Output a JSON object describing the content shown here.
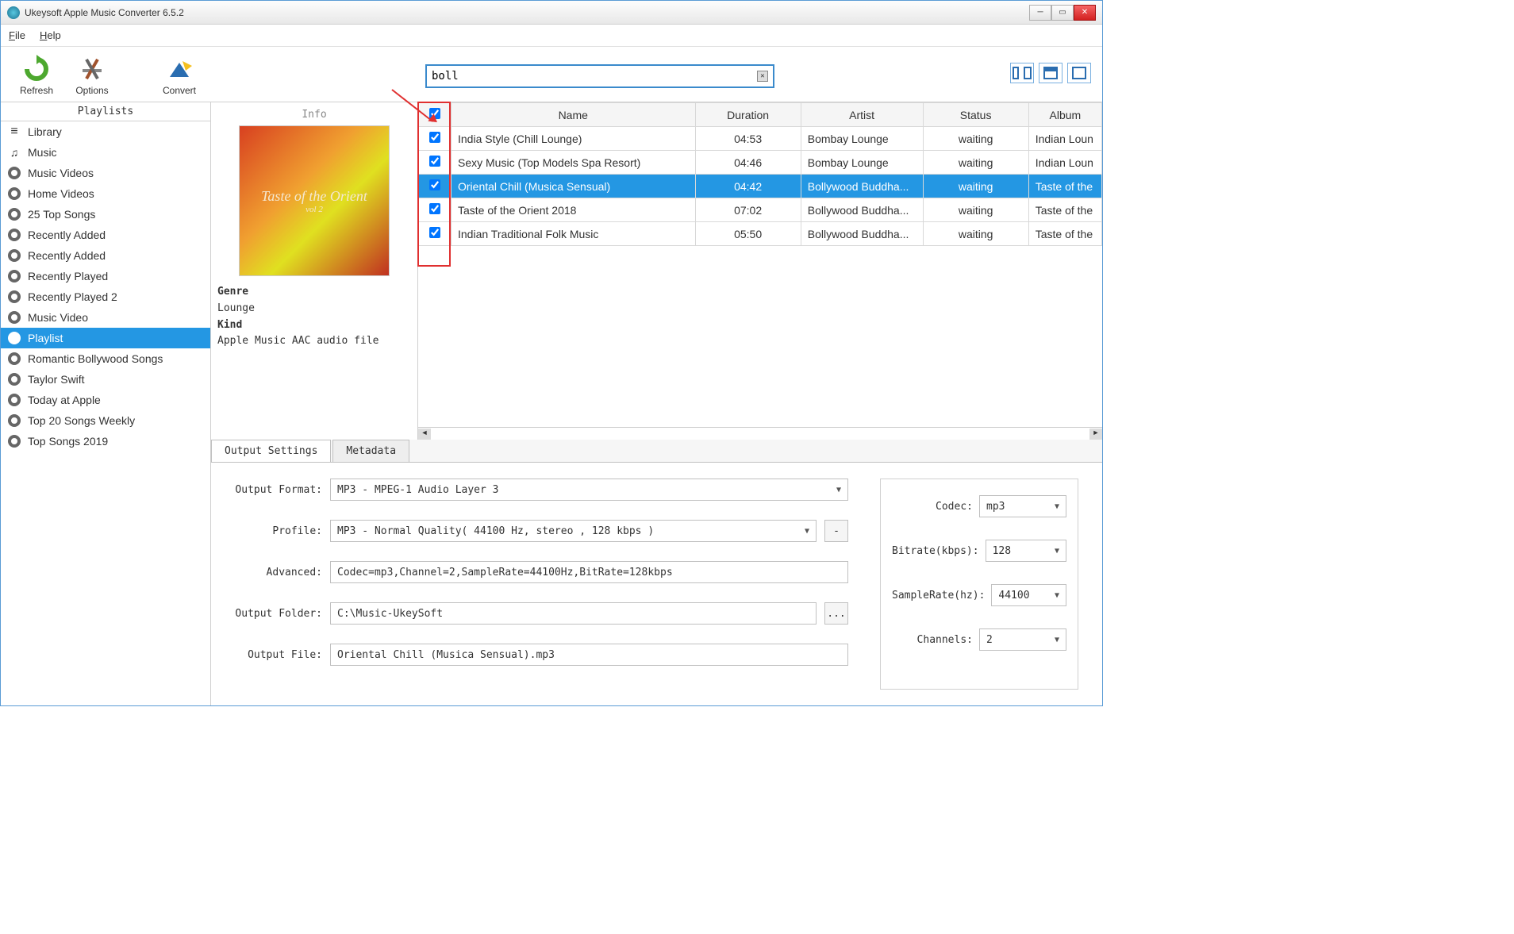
{
  "window": {
    "title": "Ukeysoft Apple Music Converter 6.5.2"
  },
  "menu": {
    "file": "File",
    "help": "Help"
  },
  "toolbar": {
    "refresh": "Refresh",
    "options": "Options",
    "convert": "Convert"
  },
  "search": {
    "value": "boll"
  },
  "sidebar": {
    "header": "Playlists",
    "items": [
      {
        "label": "Library",
        "icon": "list"
      },
      {
        "label": "Music",
        "icon": "note"
      },
      {
        "label": "Music Videos",
        "icon": "gear"
      },
      {
        "label": "Home Videos",
        "icon": "gear"
      },
      {
        "label": "25 Top Songs",
        "icon": "gear"
      },
      {
        "label": "Recently Added",
        "icon": "gear"
      },
      {
        "label": "Recently Added",
        "icon": "gear"
      },
      {
        "label": "Recently Played",
        "icon": "gear"
      },
      {
        "label": "Recently Played 2",
        "icon": "gear"
      },
      {
        "label": "Music Video",
        "icon": "gear"
      },
      {
        "label": "Playlist",
        "icon": "gear",
        "selected": true
      },
      {
        "label": "Romantic Bollywood Songs",
        "icon": "gear"
      },
      {
        "label": "Taylor Swift",
        "icon": "gear"
      },
      {
        "label": "Today at Apple",
        "icon": "gear"
      },
      {
        "label": "Top 20 Songs Weekly",
        "icon": "gear"
      },
      {
        "label": "Top Songs 2019",
        "icon": "gear"
      }
    ]
  },
  "info": {
    "header": "Info",
    "album_line1": "Taste of the Orient",
    "album_line2": "vol 2",
    "genre_label": "Genre",
    "genre": "Lounge",
    "kind_label": "Kind",
    "kind": "Apple Music AAC audio file"
  },
  "table": {
    "columns": {
      "name": "Name",
      "duration": "Duration",
      "artist": "Artist",
      "status": "Status",
      "album": "Album"
    },
    "rows": [
      {
        "name": "India Style (Chill Lounge)",
        "duration": "04:53",
        "artist": "Bombay Lounge",
        "status": "waiting",
        "album": "Indian Loun"
      },
      {
        "name": "Sexy Music (Top Models Spa Resort)",
        "duration": "04:46",
        "artist": "Bombay Lounge",
        "status": "waiting",
        "album": "Indian Loun"
      },
      {
        "name": "Oriental Chill (Musica Sensual)",
        "duration": "04:42",
        "artist": "Bollywood Buddha...",
        "status": "waiting",
        "album": "Taste of the",
        "selected": true
      },
      {
        "name": "Taste of the Orient 2018",
        "duration": "07:02",
        "artist": "Bollywood Buddha...",
        "status": "waiting",
        "album": "Taste of the"
      },
      {
        "name": "Indian Traditional Folk Music",
        "duration": "05:50",
        "artist": "Bollywood Buddha...",
        "status": "waiting",
        "album": "Taste of the"
      }
    ]
  },
  "tabs": {
    "output": "Output Settings",
    "metadata": "Metadata"
  },
  "settings": {
    "labels": {
      "format": "Output Format:",
      "profile": "Profile:",
      "advanced": "Advanced:",
      "folder": "Output Folder:",
      "file": "Output File:",
      "codec": "Codec:",
      "bitrate": "Bitrate(kbps):",
      "samplerate": "SampleRate(hz):",
      "channels": "Channels:"
    },
    "format": "MP3 - MPEG-1 Audio Layer 3",
    "profile": "MP3 - Normal Quality( 44100 Hz, stereo , 128 kbps )",
    "profile_btn": "-",
    "advanced": "Codec=mp3,Channel=2,SampleRate=44100Hz,BitRate=128kbps",
    "folder": "C:\\Music-UkeySoft",
    "folder_btn": "...",
    "file": "Oriental Chill (Musica Sensual).mp3",
    "codec": "mp3",
    "bitrate": "128",
    "samplerate": "44100",
    "channels": "2"
  }
}
